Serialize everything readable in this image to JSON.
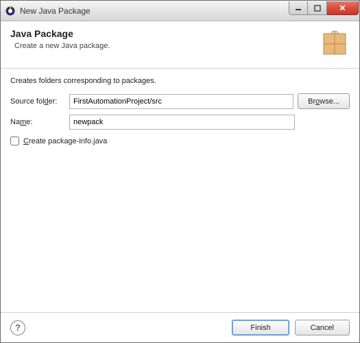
{
  "window": {
    "title": "New Java Package"
  },
  "header": {
    "title": "Java Package",
    "subtitle": "Create a new Java package."
  },
  "form": {
    "description": "Creates folders corresponding to packages.",
    "source_folder_label": "Source folder:",
    "source_folder_value": "FirstAutomationProject/src",
    "browse_label": "Browse...",
    "name_label": "Name:",
    "name_value": "newpack",
    "create_pkginfo_label": "Create package-info.java"
  },
  "buttons": {
    "finish": "Finish",
    "cancel": "Cancel"
  }
}
